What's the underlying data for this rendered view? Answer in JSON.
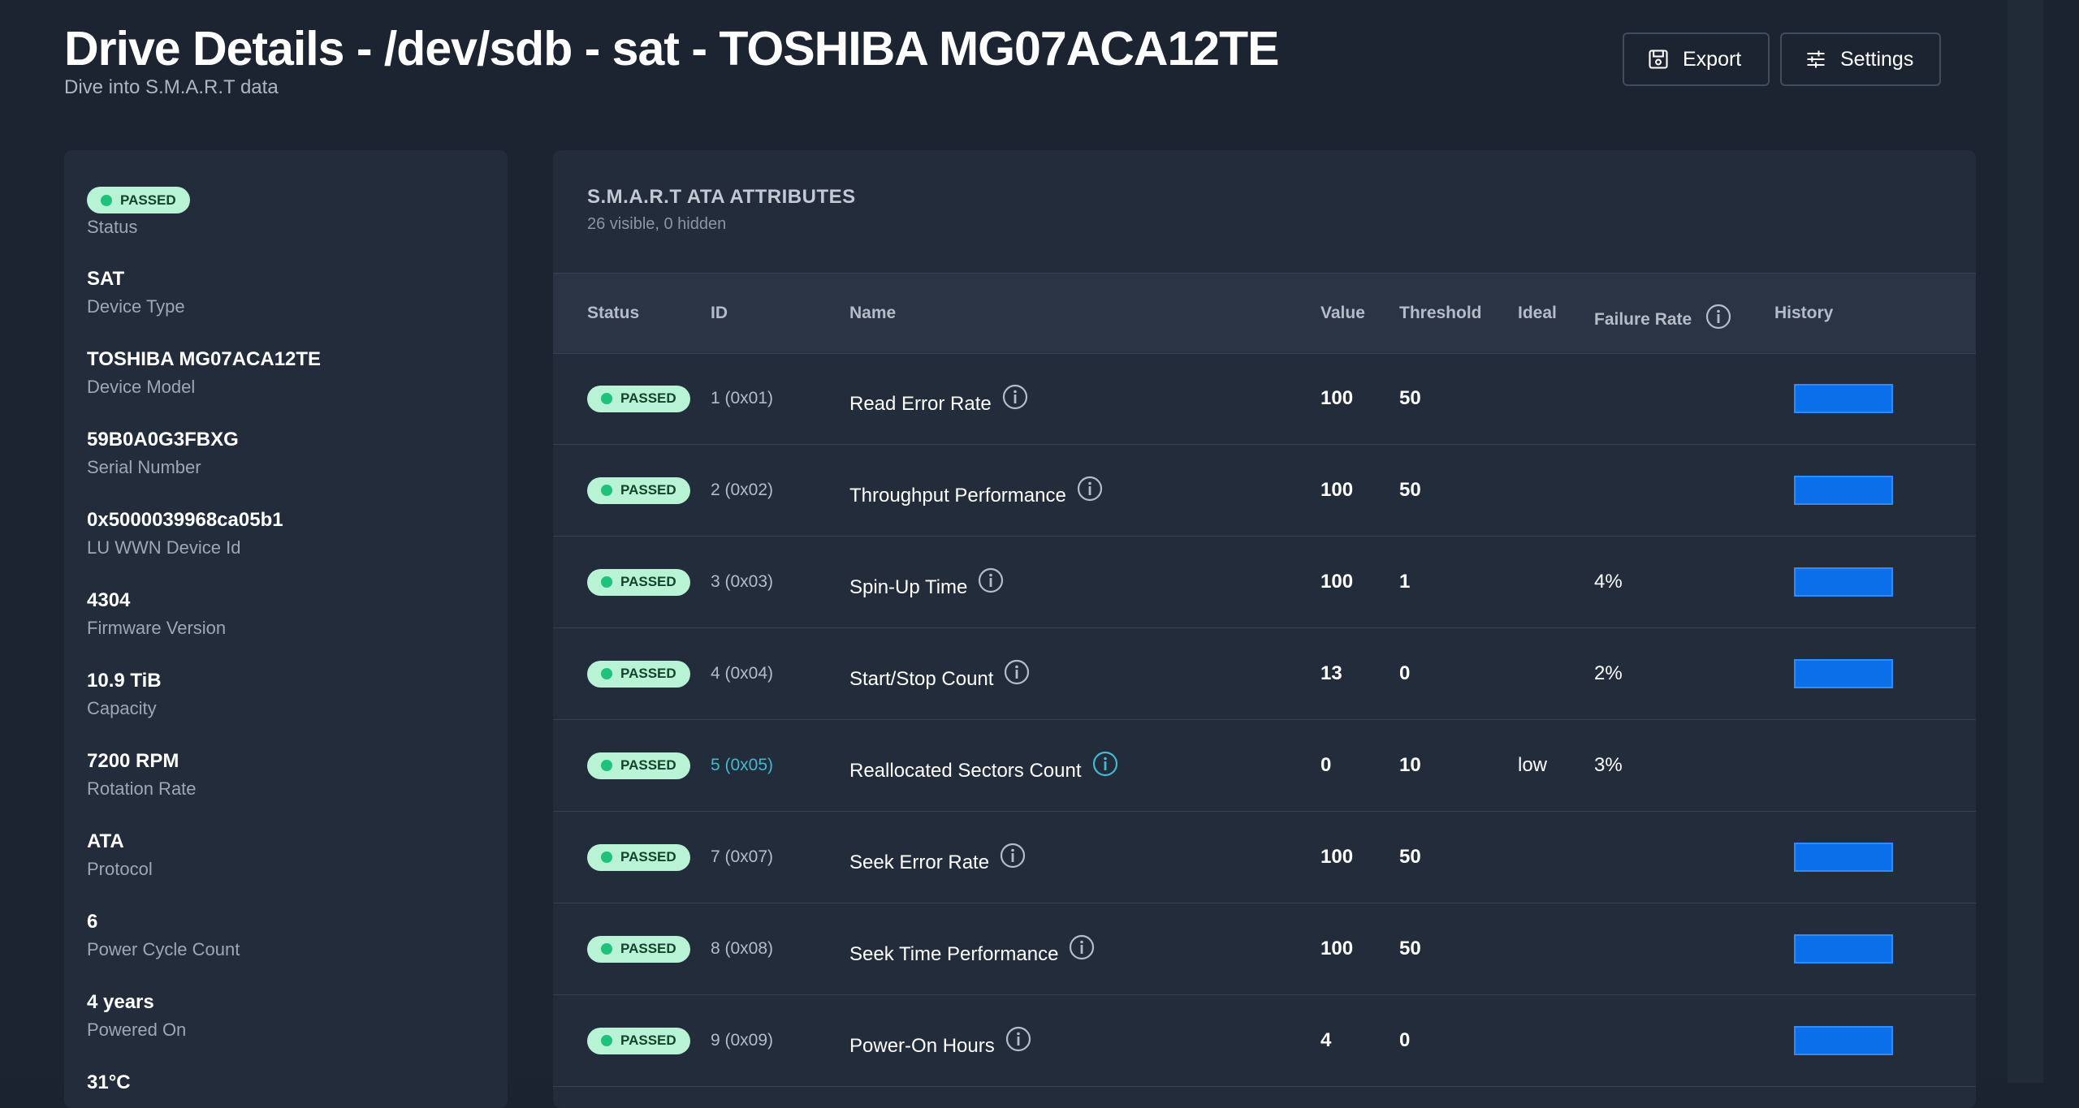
{
  "header": {
    "title": "Drive Details - /dev/sdb - sat - TOSHIBA MG07ACA12TE",
    "subtitle": "Dive into S.M.A.R.T data"
  },
  "toolbar": {
    "export_label": "Export",
    "settings_label": "Settings"
  },
  "device_info": {
    "status_badge": "PASSED",
    "status_label": "Status",
    "items": [
      {
        "value": "SAT",
        "label": "Device Type"
      },
      {
        "value": "TOSHIBA MG07ACA12TE",
        "label": "Device Model"
      },
      {
        "value": "59B0A0G3FBXG",
        "label": "Serial Number"
      },
      {
        "value": "0x5000039968ca05b1",
        "label": "LU WWN Device Id"
      },
      {
        "value": "4304",
        "label": "Firmware Version"
      },
      {
        "value": "10.9 TiB",
        "label": "Capacity"
      },
      {
        "value": "7200 RPM",
        "label": "Rotation Rate"
      },
      {
        "value": "ATA",
        "label": "Protocol"
      },
      {
        "value": "6",
        "label": "Power Cycle Count"
      },
      {
        "value": "4 years",
        "label": "Powered On"
      },
      {
        "value": "31°C",
        "label": ""
      }
    ]
  },
  "attributes_table": {
    "title": "S.M.A.R.T ATA ATTRIBUTES",
    "subtitle": "26 visible, 0 hidden",
    "columns": {
      "status": "Status",
      "id": "ID",
      "name": "Name",
      "value": "Value",
      "threshold": "Threshold",
      "ideal": "Ideal",
      "failure_rate": "Failure Rate",
      "history": "History"
    },
    "rows": [
      {
        "status": "PASSED",
        "id": "1 (0x01)",
        "name": "Read Error Rate",
        "value": "100",
        "threshold": "50",
        "ideal": "",
        "failure_rate": "",
        "history": true
      },
      {
        "status": "PASSED",
        "id": "2 (0x02)",
        "name": "Throughput Performance",
        "value": "100",
        "threshold": "50",
        "ideal": "",
        "failure_rate": "",
        "history": true
      },
      {
        "status": "PASSED",
        "id": "3 (0x03)",
        "name": "Spin-Up Time",
        "value": "100",
        "threshold": "1",
        "ideal": "",
        "failure_rate": "4%",
        "history": true
      },
      {
        "status": "PASSED",
        "id": "4 (0x04)",
        "name": "Start/Stop Count",
        "value": "13",
        "threshold": "0",
        "ideal": "",
        "failure_rate": "2%",
        "history": true
      },
      {
        "status": "PASSED",
        "id": "5 (0x05)",
        "name": "Reallocated Sectors Count",
        "value": "0",
        "threshold": "10",
        "ideal": "low",
        "failure_rate": "3%",
        "history": false,
        "highlight": true
      },
      {
        "status": "PASSED",
        "id": "7 (0x07)",
        "name": "Seek Error Rate",
        "value": "100",
        "threshold": "50",
        "ideal": "",
        "failure_rate": "",
        "history": true
      },
      {
        "status": "PASSED",
        "id": "8 (0x08)",
        "name": "Seek Time Performance",
        "value": "100",
        "threshold": "50",
        "ideal": "",
        "failure_rate": "",
        "history": true
      },
      {
        "status": "PASSED",
        "id": "9 (0x09)",
        "name": "Power-On Hours",
        "value": "4",
        "threshold": "0",
        "ideal": "",
        "failure_rate": "",
        "history": true
      }
    ]
  },
  "colors": {
    "background": "#1c2431",
    "panel": "#232c3b",
    "badge_bg": "#b9f3d6",
    "badge_dot": "#1ec27a",
    "history_bar": "#0a6fe8",
    "link": "#3fbad1"
  },
  "icons": {
    "export": "save-icon",
    "settings": "sliders-icon",
    "info": "info-circle-icon"
  }
}
